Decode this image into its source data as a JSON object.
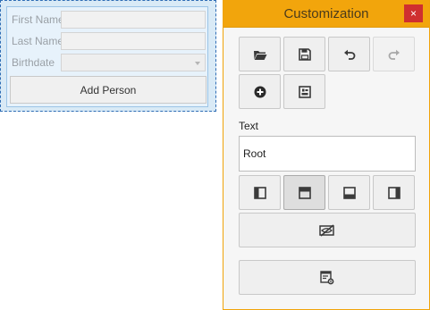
{
  "form": {
    "first_name_label": "First Name",
    "last_name_label": "Last Name",
    "birthdate_label": "Birthdate",
    "add_button_label": "Add Person"
  },
  "customization": {
    "title": "Customization",
    "close_glyph": "×",
    "text_label": "Text",
    "text_value": "Root",
    "toolbar": [
      {
        "name": "open-folder",
        "icon": "folder-icon",
        "state": "normal"
      },
      {
        "name": "save",
        "icon": "floppy-disk-icon",
        "state": "normal"
      },
      {
        "name": "undo",
        "icon": "undo-icon",
        "state": "normal"
      },
      {
        "name": "redo",
        "icon": "redo-icon",
        "state": "disabled"
      },
      {
        "name": "add-item",
        "icon": "plus-circle-icon",
        "state": "normal"
      },
      {
        "name": "layout-item",
        "icon": "layout-item-icon",
        "state": "normal"
      }
    ],
    "label_positions": [
      {
        "name": "label-left",
        "icon": "label-left-icon",
        "state": "normal"
      },
      {
        "name": "label-top",
        "icon": "label-top-icon",
        "state": "pressed"
      },
      {
        "name": "label-bottom",
        "icon": "label-bottom-icon",
        "state": "normal"
      },
      {
        "name": "label-right",
        "icon": "label-right-icon",
        "state": "normal"
      }
    ],
    "hide_label_icon": "hide-label-icon",
    "properties_icon": "properties-icon"
  },
  "colors": {
    "titlebar": "#f2a50c",
    "close": "#cf2f2f",
    "form_selection": "#2f6db5"
  }
}
